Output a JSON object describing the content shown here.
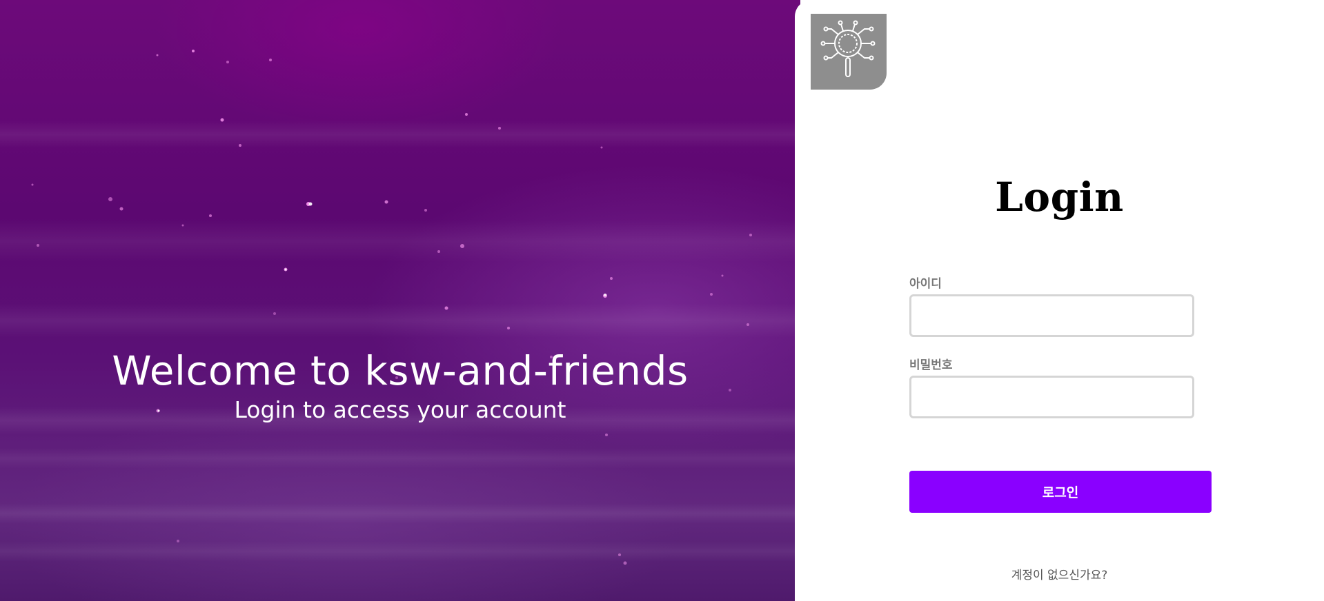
{
  "hero": {
    "title": "Welcome to ksw-and-friends",
    "subtitle": "Login to access your account"
  },
  "logo": {
    "icon": "magnifier-circuit-icon"
  },
  "login": {
    "title": "Login",
    "id_label": "아이디",
    "id_value": "",
    "password_label": "비밀번호",
    "password_value": "",
    "submit_label": "로그인",
    "signup_link": "계정이 없으신가요?"
  },
  "colors": {
    "hero_background": "#5c0871",
    "button": "#8a00ff",
    "logo_background": "#8e8e8e"
  }
}
